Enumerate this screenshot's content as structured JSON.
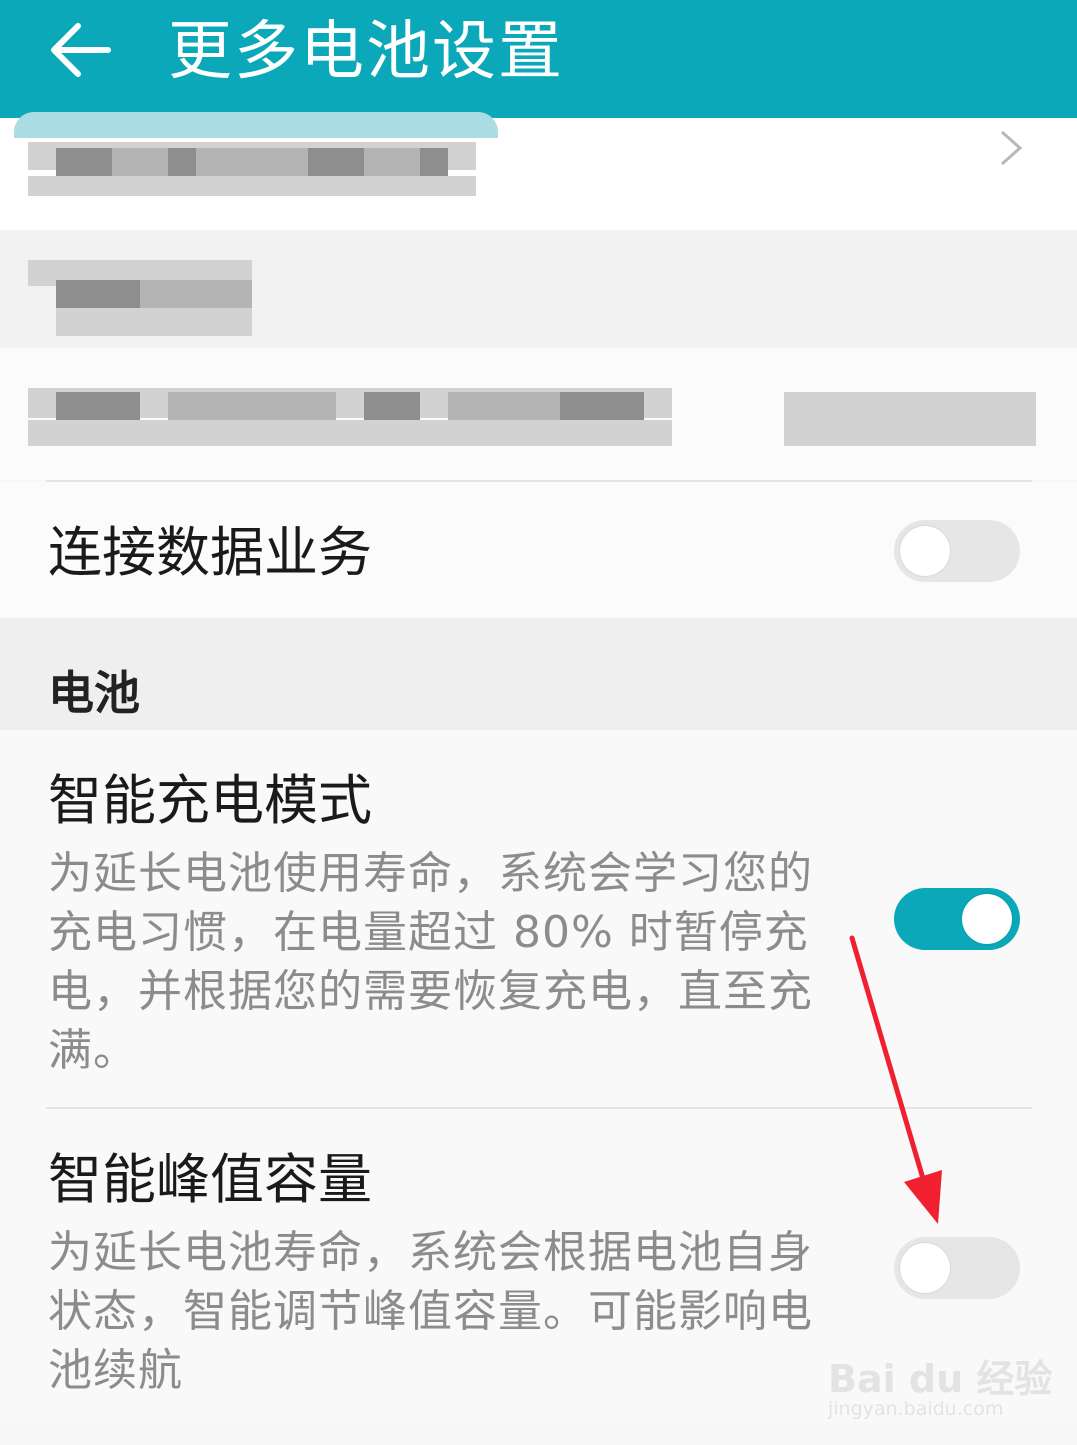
{
  "header": {
    "title": "更多电池设置",
    "back_icon": "back-arrow-icon",
    "background": "#0aa8b8"
  },
  "items": {
    "data_service": {
      "title": "连接数据业务",
      "toggle_on": false
    },
    "battery_section": "电池",
    "smart_charge": {
      "title": "智能充电模式",
      "desc": "为延长电池使用寿命，系统会学习您的充电习惯，在电量超过 80% 时暂停充电，并根据您的需要恢复充电，直至充满。",
      "toggle_on": true
    },
    "smart_peak": {
      "title": "智能峰值容量",
      "desc": "为延长电池寿命，系统会根据电池自身状态，智能调节峰值容量。可能影响电池续航",
      "toggle_on": false
    }
  },
  "watermark": {
    "brand": "Bai du 经验",
    "url": "jingyan.baidu.com"
  },
  "colors": {
    "accent": "#0aa8b8",
    "annotation_arrow": "#f02030"
  }
}
